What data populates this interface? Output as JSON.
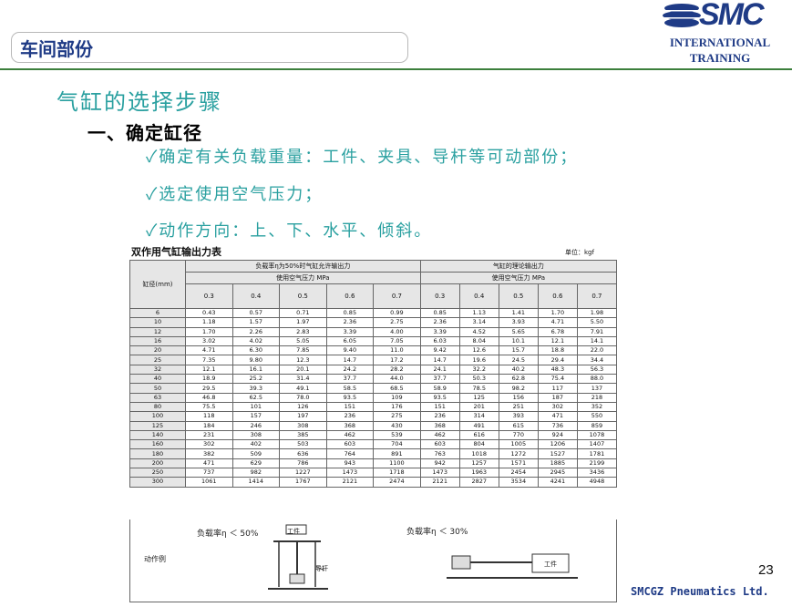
{
  "header": {
    "section_title": "车间部份",
    "logo_text": "SMC",
    "logo_line1": "INTERNATIONAL",
    "logo_line2": "TRAINING"
  },
  "content": {
    "title": "气缸的选择步骤",
    "subtitle": "一、确定缸径",
    "bullets": [
      "✓确定有关负载重量：工件、夹具、导杆等可动部份；",
      "✓选定使用空气压力；",
      "✓动作方向：上、下、水平、倾斜。"
    ]
  },
  "table": {
    "title": "双作用气缸输出力表",
    "unit": "单位：kgf",
    "bore_header": "缸径(mm)",
    "group1_header": "负载率η为50%时气缸允许输出力",
    "group2_header": "气缸的理论输出力",
    "pressure_label": "使用空气压力  MPa",
    "pressures": [
      "0.3",
      "0.4",
      "0.5",
      "0.6",
      "0.7",
      "0.3",
      "0.4",
      "0.5",
      "0.6",
      "0.7"
    ],
    "rows": [
      [
        "6",
        "0.43",
        "0.57",
        "0.71",
        "0.85",
        "0.99",
        "0.85",
        "1.13",
        "1.41",
        "1.70",
        "1.98"
      ],
      [
        "10",
        "1.18",
        "1.57",
        "1.97",
        "2.36",
        "2.75",
        "2.36",
        "3.14",
        "3.93",
        "4.71",
        "5.50"
      ],
      [
        "12",
        "1.70",
        "2.26",
        "2.83",
        "3.39",
        "4.00",
        "3.39",
        "4.52",
        "5.65",
        "6.78",
        "7.91"
      ],
      [
        "16",
        "3.02",
        "4.02",
        "5.05",
        "6.05",
        "7.05",
        "6.03",
        "8.04",
        "10.1",
        "12.1",
        "14.1"
      ],
      [
        "20",
        "4.71",
        "6.30",
        "7.85",
        "9.40",
        "11.0",
        "9.42",
        "12.6",
        "15.7",
        "18.8",
        "22.0"
      ],
      [
        "25",
        "7.35",
        "9.80",
        "12.3",
        "14.7",
        "17.2",
        "14.7",
        "19.6",
        "24.5",
        "29.4",
        "34.4"
      ],
      [
        "32",
        "12.1",
        "16.1",
        "20.1",
        "24.2",
        "28.2",
        "24.1",
        "32.2",
        "40.2",
        "48.3",
        "56.3"
      ],
      [
        "40",
        "18.9",
        "25.2",
        "31.4",
        "37.7",
        "44.0",
        "37.7",
        "50.3",
        "62.8",
        "75.4",
        "88.0"
      ],
      [
        "50",
        "29.5",
        "39.3",
        "49.1",
        "58.5",
        "68.5",
        "58.9",
        "78.5",
        "98.2",
        "117",
        "137"
      ],
      [
        "63",
        "46.8",
        "62.5",
        "78.0",
        "93.5",
        "109",
        "93.5",
        "125",
        "156",
        "187",
        "218"
      ],
      [
        "80",
        "75.5",
        "101",
        "126",
        "151",
        "176",
        "151",
        "201",
        "251",
        "302",
        "352"
      ],
      [
        "100",
        "118",
        "157",
        "197",
        "236",
        "275",
        "236",
        "314",
        "393",
        "471",
        "550"
      ],
      [
        "125",
        "184",
        "246",
        "308",
        "368",
        "430",
        "368",
        "491",
        "615",
        "736",
        "859"
      ],
      [
        "140",
        "231",
        "308",
        "385",
        "462",
        "539",
        "462",
        "616",
        "770",
        "924",
        "1078"
      ],
      [
        "160",
        "302",
        "402",
        "503",
        "603",
        "704",
        "603",
        "804",
        "1005",
        "1206",
        "1407"
      ],
      [
        "180",
        "382",
        "509",
        "636",
        "764",
        "891",
        "763",
        "1018",
        "1272",
        "1527",
        "1781"
      ],
      [
        "200",
        "471",
        "629",
        "786",
        "943",
        "1100",
        "942",
        "1257",
        "1571",
        "1885",
        "2199"
      ],
      [
        "250",
        "737",
        "982",
        "1227",
        "1473",
        "1718",
        "1473",
        "1963",
        "2454",
        "2945",
        "3436"
      ],
      [
        "300",
        "1061",
        "1414",
        "1767",
        "2121",
        "2474",
        "2121",
        "2827",
        "3534",
        "4241",
        "4948"
      ]
    ]
  },
  "examples": {
    "label": "动作例",
    "ex1_caption": "负载率η ＜ 50%",
    "ex1_work": "工件",
    "ex1_guide": "导杆",
    "ex2_caption": "负载率η ＜ 30%",
    "ex2_work": "工件"
  },
  "footer": {
    "page_number": "23",
    "company": "SMCGZ  Pneumatics  Ltd."
  },
  "colors": {
    "brand_blue": "#1f3b86",
    "teal": "#2aa0a0",
    "green_rule": "#3c7f3c"
  }
}
